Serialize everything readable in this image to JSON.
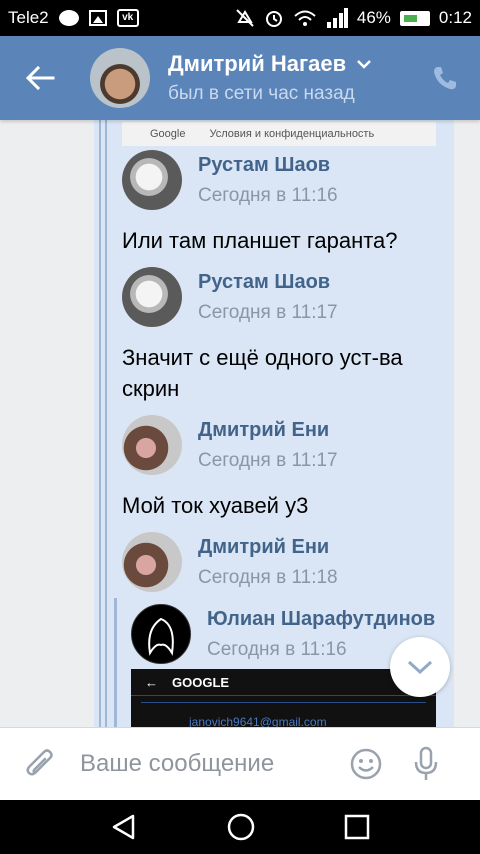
{
  "status_bar": {
    "carrier": "Tele2",
    "battery_percent": "46%",
    "time": "0:12",
    "icons": [
      "message-icon",
      "image-icon",
      "vk-notification-icon",
      "mute-icon",
      "alarm-icon",
      "wifi-icon",
      "signal-icon",
      "battery-icon"
    ]
  },
  "header": {
    "contact_name": "Дмитрий Нагаев",
    "contact_status": "был в сети час назад",
    "background_color": "#5b84b8"
  },
  "google_bar": {
    "brand": "Google",
    "link": "Условия и конфиденциальность"
  },
  "messages": [
    {
      "author": "Рустам Шаов",
      "time": "Сегодня в 11:16",
      "text": "Или там планшет гаранта?"
    },
    {
      "author": "Рустам Шаов",
      "time": "Сегодня в 11:17",
      "text": "Значит с ещё одного уст-ва скрин"
    },
    {
      "author": "Дмитрий Ени",
      "time": "Сегодня в 11:17",
      "text": "Мой ток хуавей у3"
    },
    {
      "author": "Дмитрий Ени",
      "time": "Сегодня в 11:18",
      "text": ""
    }
  ],
  "nested_message": {
    "author": "Юлиан Шарафутдинов",
    "time": "Сегодня в 11:16",
    "screenshot_title": "GOOGLE",
    "screenshot_email": "janovich9641@gmail.com"
  },
  "input": {
    "placeholder": "Ваше сообщение"
  },
  "colors": {
    "name_link": "#42648b",
    "bubble_bg": "#dae6f5",
    "thread_rule": "#9fb8d8"
  }
}
